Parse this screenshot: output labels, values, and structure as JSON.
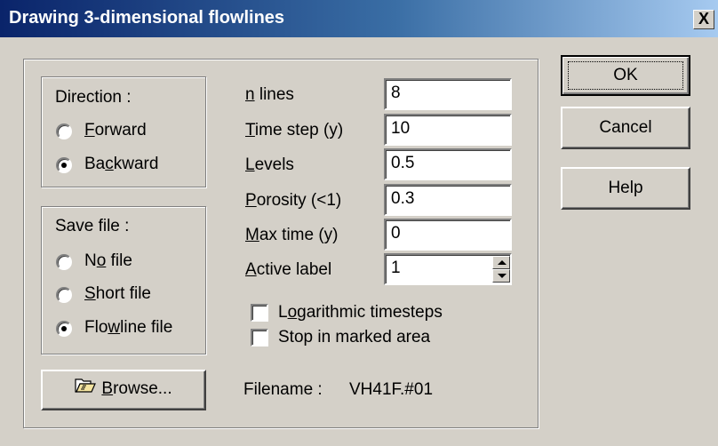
{
  "window": {
    "title": "Drawing 3-dimensional flowlines",
    "close_label": "X"
  },
  "direction": {
    "heading": "Direction :",
    "options": [
      {
        "label_pre": "",
        "label_accel": "F",
        "label_post": "orward",
        "selected": false
      },
      {
        "label_pre": "Ba",
        "label_accel": "c",
        "label_post": "kward",
        "selected": true
      }
    ]
  },
  "save_file": {
    "heading": "Save file :",
    "options": [
      {
        "label_pre": "N",
        "label_accel": "o",
        "label_post": " file",
        "selected": false
      },
      {
        "label_pre": "",
        "label_accel": "S",
        "label_post": "hort file",
        "selected": false
      },
      {
        "label_pre": "Flo",
        "label_accel": "w",
        "label_post": "line file",
        "selected": true
      }
    ]
  },
  "params": {
    "n_lines": {
      "label_accel": "n",
      "label_post": " lines",
      "value": "8"
    },
    "time_step": {
      "label_accel": "T",
      "label_post": "ime step (y)",
      "value": "10"
    },
    "levels": {
      "label_accel": "L",
      "label_post": "evels",
      "value": "0.5"
    },
    "porosity": {
      "label_accel": "P",
      "label_post": "orosity (<1)",
      "value": "0.3"
    },
    "max_time": {
      "label_accel": "M",
      "label_post": "ax time  (y)",
      "value": "0"
    },
    "active_label": {
      "label_accel": "A",
      "label_post": "ctive label",
      "value": "1"
    }
  },
  "checkboxes": {
    "logarithmic": {
      "label_pre": "L",
      "label_accel": "o",
      "label_post": "garithmic timesteps",
      "checked": false
    },
    "stop_marked": {
      "label": "Stop in marked area",
      "checked": false
    }
  },
  "browse": {
    "label_accel": "B",
    "label_post": "rowse...",
    "icon": "folder-open-icon"
  },
  "filename": {
    "label": "Filename :",
    "value": "VH41F.#01"
  },
  "buttons": {
    "ok": "OK",
    "cancel": "Cancel",
    "help": "Help"
  }
}
